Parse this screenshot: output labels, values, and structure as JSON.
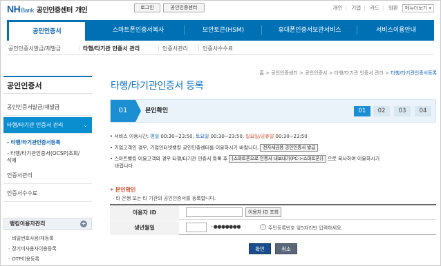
{
  "header": {
    "logo_nh": "NH",
    "logo_bank": "Bank",
    "service_name": "공인인증센터",
    "type": "개인",
    "login_btn": "로그인",
    "cert_center_btn": "공인인증센터",
    "links": [
      "개인",
      "기업",
      "카드",
      "외환"
    ],
    "menu_select": "메뉴더보기 ▾"
  },
  "gnb": {
    "tabs": [
      "공인인증서",
      "스마트폰인증서복사",
      "보안토큰(HSM)",
      "휴대폰인증서보관서비스",
      "서비스이용안내"
    ],
    "active_index": 0
  },
  "subnav": {
    "items": [
      "공인인증서발급/재발급",
      "타행/타기관 인증서 관리",
      "인증서관리",
      "인증서수수료"
    ],
    "current_index": 1
  },
  "lnb": {
    "title": "공인인증서",
    "items": [
      "공인인증서발급/재발급",
      "타행/타기관 인증서 관리",
      "인증서관리",
      "인증서수수료"
    ],
    "active_chev": "⌄",
    "subitems": [
      "- 타행/타기관인증서등록",
      "- 타행/타기관인증서(OCSP)조회/",
      "  삭제"
    ],
    "bank_user_title": "뱅킹이용자관리",
    "bank_user_plus": "+",
    "bank_user_items": [
      "비밀번호사용/재등록",
      "장기미사용자이용등록",
      "OTP이용등록"
    ]
  },
  "content": {
    "breadcrumb": [
      "홈",
      "공인인증센터",
      "공인인증서",
      "타행/타기관 인증서 관리"
    ],
    "breadcrumb_last": "타행/타기관인증서등록",
    "breadcrumb_sep": ">",
    "page_title": "타행/타기관인증서 등록",
    "step_current_num": "01",
    "step_current_label": "본인확인",
    "steps": [
      "01",
      "02",
      "03",
      "04"
    ],
    "step_dots": "······",
    "info1_prefix": "• 서비스 이용시간: ",
    "info1_weekday_label": "평일",
    "info1_weekday_time": " 00:30~23:50,",
    "info1_sat_label": "토요일",
    "info1_sat_time": " 00:30~23:50,",
    "info1_hol_label": "일요일/공휴일",
    "info1_hol_time": " 00:30~23:50",
    "info2_text": "• 기업고객인 경우, 기업인터넷뱅킹 공인인증센터를 이용하시기 바랍니다.",
    "info2_btn": "전자세금용 공인인증서 발급",
    "info3_line1_a": "• 스마트뱅킹 이용고객의 경우 타행/타기관 인증서 등록 후",
    "info3_btn": "[스마트폰으로 인증서 내보내기(PC->스마트폰)]",
    "info3_line1_b": "으로 복사하여 이용하시기",
    "info3_line2": "바랍니다.",
    "section_title": "• 본인확인",
    "section_desc": "- 타 은행 또는 타 기관의 공인인증서를 등록합니다.",
    "form": {
      "user_id_label": "이용자 ID",
      "user_id_value": "",
      "user_id_btn": "이용자 ID 조회",
      "dob_label": "생년월일",
      "dob_value": "",
      "dob_mask": "- ●●●●●●●",
      "excl": "!",
      "dob_note": "주민등록번호 앞5자리만 입력하세요."
    },
    "ok_btn": "확인",
    "cancel_btn": "취소"
  }
}
